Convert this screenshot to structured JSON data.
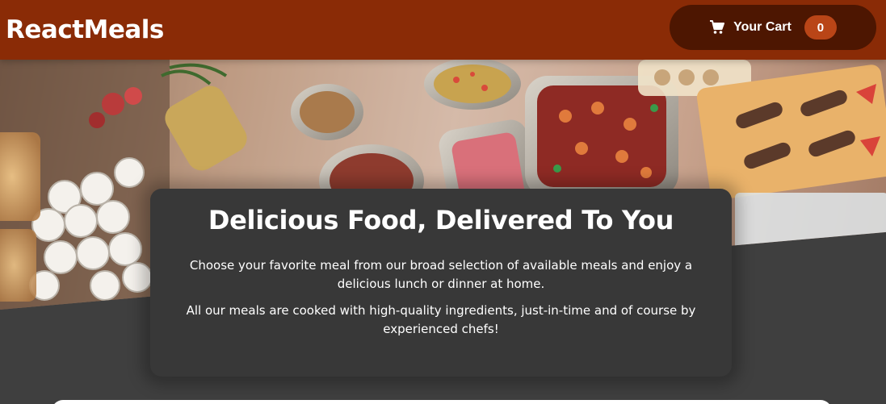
{
  "header": {
    "brand": "ReactMeals",
    "cart": {
      "label": "Your Cart",
      "count": "0",
      "icon": "cart-icon"
    }
  },
  "summary": {
    "title": "Delicious Food, Delivered To You",
    "paragraph_1": "Choose your favorite meal from our broad selection of available meals and enjoy a delicious lunch or dinner at home.",
    "paragraph_2": "All our meals are cooked with high-quality ingredients, just-in-time and of course by experienced chefs!"
  },
  "colors": {
    "header": "#8a2b06",
    "cart_button": "#4d1601",
    "badge": "#b94517",
    "page_background": "#3f3f3f",
    "card": "#383838"
  }
}
